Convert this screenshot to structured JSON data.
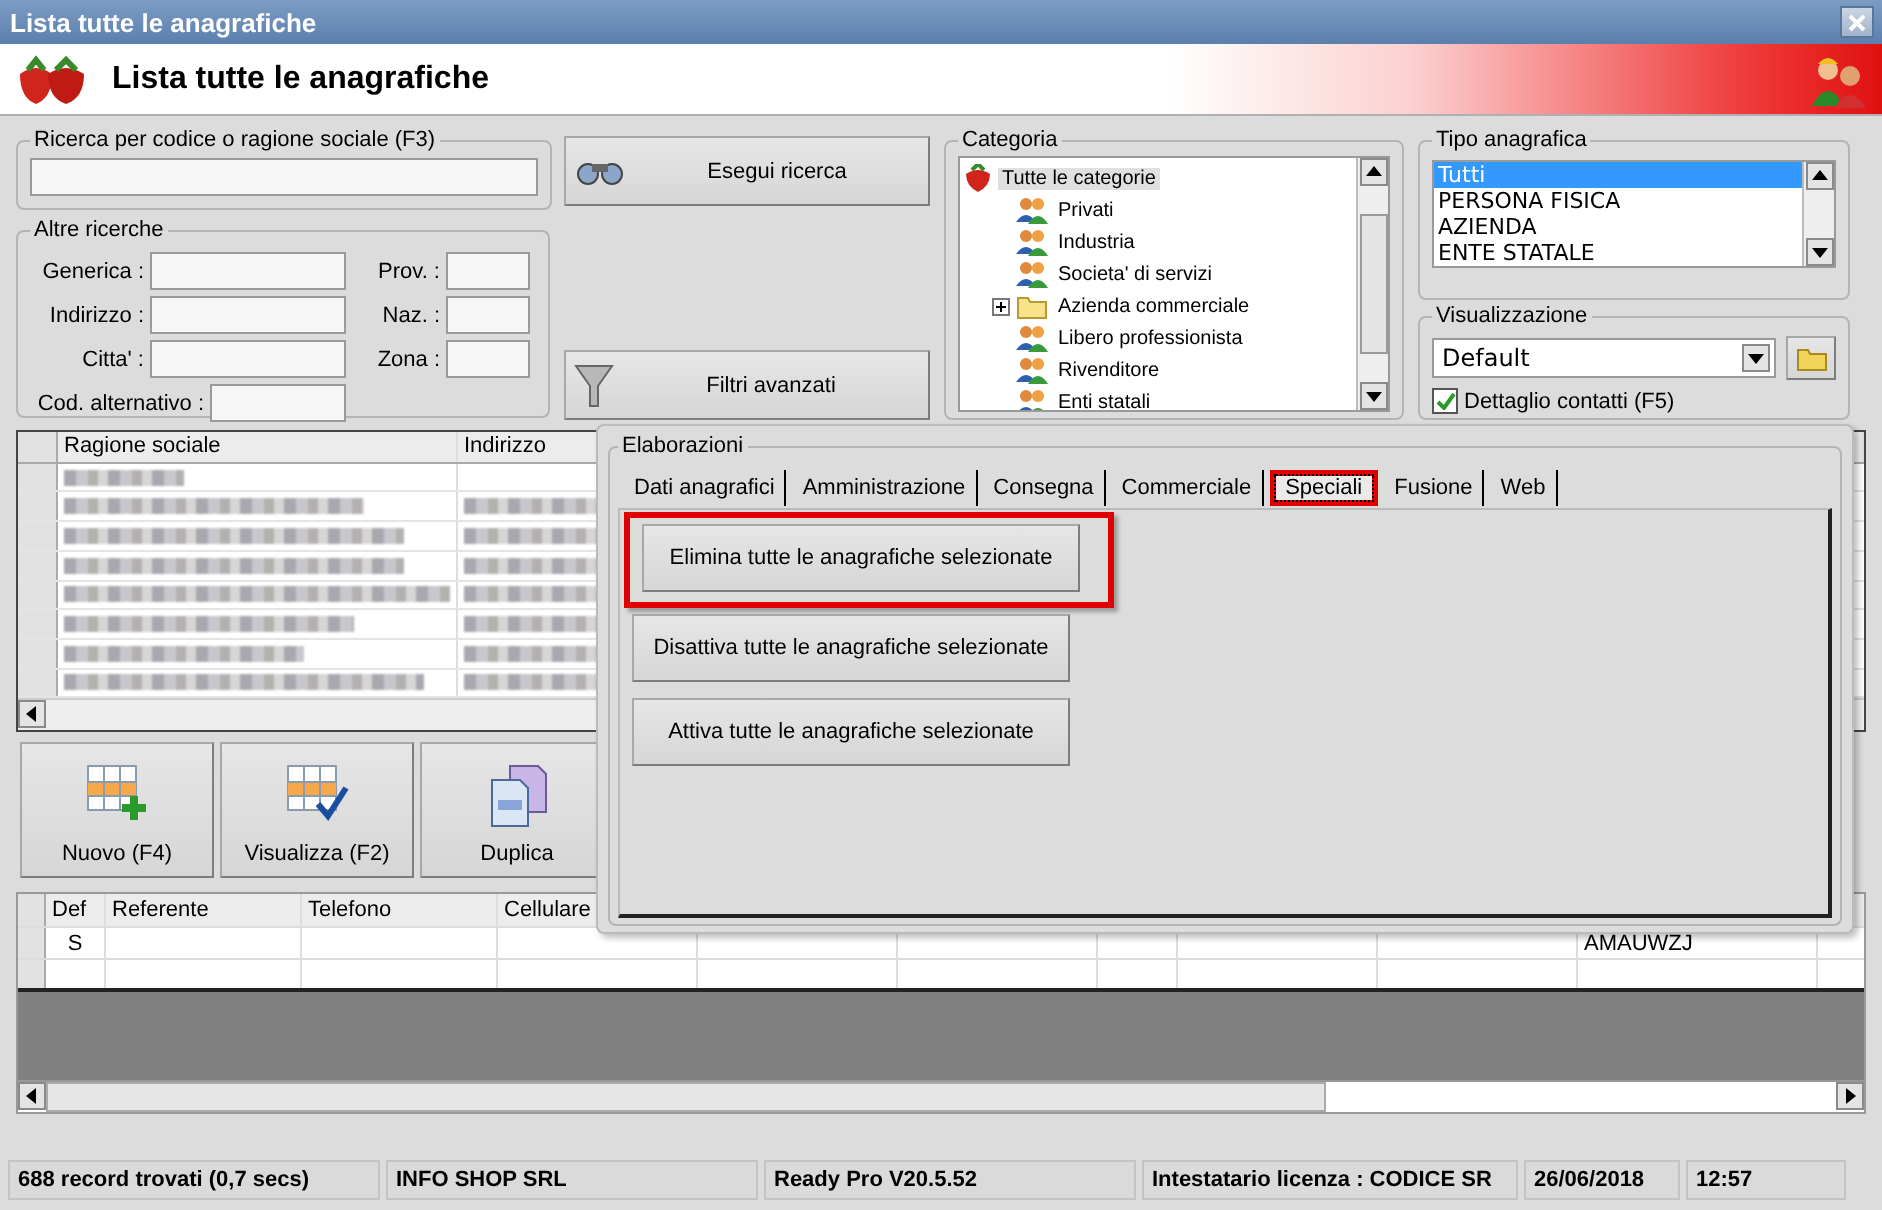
{
  "window": {
    "title": "Lista tutte le anagrafiche"
  },
  "header": {
    "title": "Lista tutte le anagrafiche"
  },
  "code_search": {
    "legend": "Ricerca per codice o ragione sociale (F3)"
  },
  "other_searches": {
    "legend": "Altre ricerche",
    "rows": [
      [
        {
          "label": "Generica :"
        },
        {
          "label": "Prov. :"
        }
      ],
      [
        {
          "label": "Indirizzo :"
        },
        {
          "label": "Naz. :"
        }
      ],
      [
        {
          "label": "Citta' :"
        },
        {
          "label": "Zona :"
        }
      ],
      [
        {
          "label": "Cod. alternativo :"
        }
      ]
    ]
  },
  "search_button": {
    "label": "Esegui ricerca"
  },
  "filters_button": {
    "label": "Filtri avanzati"
  },
  "categoria": {
    "legend": "Categoria",
    "tree": [
      {
        "label": "Tutte le categorie",
        "kind": "root",
        "selected": true,
        "children": [
          {
            "label": "Privati",
            "kind": "group",
            "selected": false
          },
          {
            "label": "Industria",
            "kind": "group",
            "selected": false
          },
          {
            "label": "Societa' di servizi",
            "kind": "group",
            "selected": false
          },
          {
            "label": "Azienda commerciale",
            "kind": "folder",
            "selected": false
          },
          {
            "label": "Libero professionista",
            "kind": "group",
            "selected": false
          },
          {
            "label": "Rivenditore",
            "kind": "group",
            "selected": false
          },
          {
            "label": "Enti statali",
            "kind": "group",
            "selected": false
          }
        ]
      }
    ]
  },
  "tipo_anagrafica": {
    "legend": "Tipo anagrafica",
    "items": [
      {
        "label": "Tutti",
        "selected": true
      },
      {
        "label": "PERSONA FISICA",
        "selected": false
      },
      {
        "label": "AZIENDA",
        "selected": false
      },
      {
        "label": "ENTE STATALE",
        "selected": false
      }
    ]
  },
  "visualizzazione": {
    "legend": "Visualizzazione",
    "value": "Default",
    "detail_checkbox": {
      "label": "Dettaglio contatti (F5)",
      "checked": true
    }
  },
  "grid": {
    "columns": [
      "Ragione sociale",
      "Indirizzo"
    ],
    "rows": [
      {
        "kind": "blurred"
      },
      {
        "kind": "blurred"
      },
      {
        "kind": "blurred"
      },
      {
        "kind": "blurred"
      },
      {
        "kind": "blurred"
      },
      {
        "kind": "blurred"
      },
      {
        "kind": "blurred"
      },
      {
        "kind": "blurred"
      }
    ]
  },
  "actions": [
    {
      "label": "Nuovo (F4)",
      "kind": "new"
    },
    {
      "label": "Visualizza (F2)",
      "kind": "view"
    },
    {
      "label": "Duplica",
      "kind": "duplicate"
    }
  ],
  "contacts_grid": {
    "columns": [
      "Def",
      "Referente",
      "Telefono",
      "Cellulare"
    ],
    "rows": [
      {
        "def": "S",
        "column_10": "AMAUWZJ"
      }
    ]
  },
  "elaborazioni": {
    "legend": "Elaborazioni",
    "tabs": [
      {
        "label": "Dati anagrafici",
        "selected": false,
        "highlighted": false
      },
      {
        "label": "Amministrazione",
        "selected": false,
        "highlighted": false
      },
      {
        "label": "Consegna",
        "selected": false,
        "highlighted": false
      },
      {
        "label": "Commerciale",
        "selected": false,
        "highlighted": false
      },
      {
        "label": "Speciali",
        "selected": true,
        "highlighted": true
      },
      {
        "label": "Fusione",
        "selected": false,
        "highlighted": false
      },
      {
        "label": "Web",
        "selected": false,
        "highlighted": false
      }
    ],
    "buttons": [
      {
        "label": "Elimina tutte le anagrafiche selezionate",
        "highlighted": true
      },
      {
        "label": "Disattiva tutte le anagrafiche selezionate",
        "highlighted": false
      },
      {
        "label": "Attiva tutte le anagrafiche selezionate",
        "highlighted": false
      }
    ]
  },
  "status_bar": [
    "688 record trovati (0,7 secs)",
    "INFO SHOP SRL",
    "Ready Pro V20.5.52",
    "Intestatario licenza : CODICE SR",
    "26/06/2018",
    "12:57"
  ]
}
